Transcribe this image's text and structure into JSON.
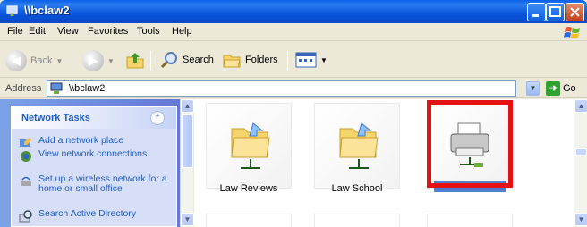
{
  "window": {
    "title": "\\\\bclaw2"
  },
  "menu": {
    "file": "File",
    "edit": "Edit",
    "view": "View",
    "favorites": "Favorites",
    "tools": "Tools",
    "help": "Help"
  },
  "toolbar": {
    "back_label": "Back",
    "search_label": "Search",
    "folders_label": "Folders"
  },
  "address": {
    "label": "Address",
    "value": "\\\\bclaw2",
    "go_label": "Go"
  },
  "tasks": {
    "title": "Network Tasks",
    "items": [
      {
        "label": "Add a network place",
        "icon": "add-network-place-icon"
      },
      {
        "label": "View network connections",
        "icon": "network-connections-icon"
      },
      {
        "label": "Set up a wireless network for a home or small office",
        "icon": "wireless-icon"
      },
      {
        "label": "Search Active Directory",
        "icon": "search-directory-icon"
      }
    ]
  },
  "items": [
    {
      "label": "Law Reviews",
      "icon": "shared-folder-icon"
    },
    {
      "label": "Law School",
      "icon": "shared-folder-icon"
    },
    {
      "label": "",
      "icon": "printer-icon",
      "selected": true
    }
  ],
  "colors": {
    "titlebar": "#0855DD",
    "highlight": "#E41212",
    "task_link": "#215DC6"
  }
}
